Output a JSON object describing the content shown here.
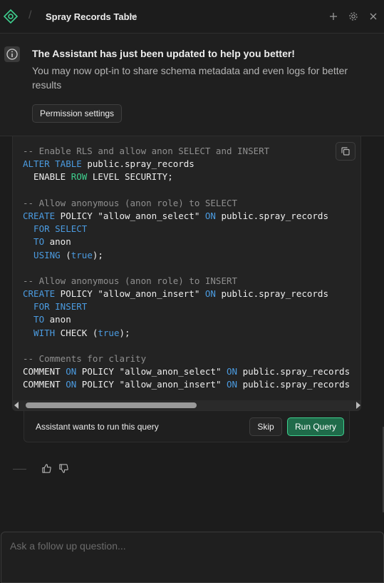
{
  "header": {
    "title": "Spray Records Table",
    "separator": "/"
  },
  "notice": {
    "title": "The Assistant has just been updated to help you better!",
    "body": "You may now opt-in to share schema metadata and even logs for better results",
    "button": "Permission settings"
  },
  "code": {
    "lines": [
      [
        {
          "c": "cm",
          "t": "-- Enable RLS and allow anon SELECT and INSERT"
        }
      ],
      [
        {
          "c": "kw",
          "t": "ALTER TABLE"
        },
        {
          "c": "tx",
          "t": " public.spray_records"
        }
      ],
      [
        {
          "c": "tx",
          "t": "  ENABLE "
        },
        {
          "c": "gr",
          "t": "ROW"
        },
        {
          "c": "tx",
          "t": " LEVEL SECURITY;"
        }
      ],
      [],
      [
        {
          "c": "cm",
          "t": "-- Allow anonymous (anon role) to SELECT"
        }
      ],
      [
        {
          "c": "kw",
          "t": "CREATE"
        },
        {
          "c": "tx",
          "t": " POLICY \"allow_anon_select\" "
        },
        {
          "c": "kw",
          "t": "ON"
        },
        {
          "c": "tx",
          "t": " public.spray_records"
        }
      ],
      [
        {
          "c": "kw",
          "t": "  FOR SELECT"
        }
      ],
      [
        {
          "c": "kw",
          "t": "  TO"
        },
        {
          "c": "tx",
          "t": " anon"
        }
      ],
      [
        {
          "c": "kw",
          "t": "  USING"
        },
        {
          "c": "tx",
          "t": " ("
        },
        {
          "c": "kw",
          "t": "true"
        },
        {
          "c": "tx",
          "t": ");"
        }
      ],
      [],
      [
        {
          "c": "cm",
          "t": "-- Allow anonymous (anon role) to INSERT"
        }
      ],
      [
        {
          "c": "kw",
          "t": "CREATE"
        },
        {
          "c": "tx",
          "t": " POLICY \"allow_anon_insert\" "
        },
        {
          "c": "kw",
          "t": "ON"
        },
        {
          "c": "tx",
          "t": " public.spray_records"
        }
      ],
      [
        {
          "c": "kw",
          "t": "  FOR INSERT"
        }
      ],
      [
        {
          "c": "kw",
          "t": "  TO"
        },
        {
          "c": "tx",
          "t": " anon"
        }
      ],
      [
        {
          "c": "kw",
          "t": "  WITH"
        },
        {
          "c": "tx",
          "t": " CHECK ("
        },
        {
          "c": "kw",
          "t": "true"
        },
        {
          "c": "tx",
          "t": ");"
        }
      ],
      [],
      [
        {
          "c": "cm",
          "t": "-- Comments for clarity"
        }
      ],
      [
        {
          "c": "tx",
          "t": "COMMENT "
        },
        {
          "c": "kw",
          "t": "ON"
        },
        {
          "c": "tx",
          "t": " POLICY \"allow_anon_select\" "
        },
        {
          "c": "kw",
          "t": "ON"
        },
        {
          "c": "tx",
          "t": " public.spray_records"
        }
      ],
      [
        {
          "c": "tx",
          "t": "COMMENT "
        },
        {
          "c": "kw",
          "t": "ON"
        },
        {
          "c": "tx",
          "t": " POLICY \"allow_anon_insert\" "
        },
        {
          "c": "kw",
          "t": "ON"
        },
        {
          "c": "tx",
          "t": " public.spray_records"
        }
      ]
    ]
  },
  "query": {
    "prompt": "Assistant wants to run this query",
    "skip": "Skip",
    "run": "Run Query"
  },
  "input": {
    "placeholder": "Ask a follow up question..."
  },
  "colors": {
    "accent": "#3ecf8e",
    "keyword": "#4b9be0",
    "comment": "#8f8f8f",
    "background": "#1c1c1c"
  },
  "icons": [
    "logo-icon",
    "chevron-down-icon",
    "plus-icon",
    "gear-icon",
    "close-icon",
    "info-icon",
    "copy-icon",
    "thumbs-up-icon",
    "thumbs-down-icon"
  ]
}
